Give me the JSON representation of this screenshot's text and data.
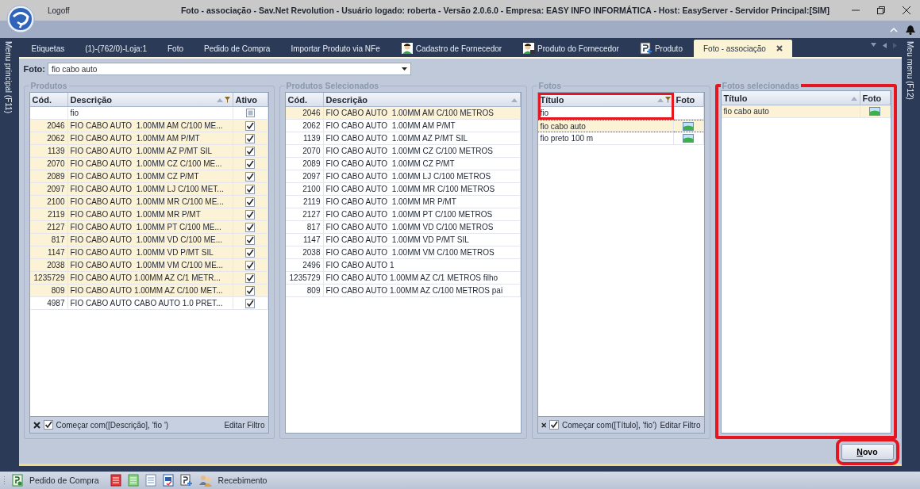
{
  "window": {
    "title": "Foto - associação - Sav.Net Revolution - Usuário logado: roberta - Versão 2.0.6.0 - Empresa: EASY INFO INFORMÁTICA - Host: EasyServer - Servidor Principal:[SIM]",
    "logoff": "Logoff"
  },
  "side_left": "Menu principal (F11)",
  "side_right": "Meu menu (F12)",
  "tabs": [
    {
      "label": "Etiquetas",
      "kind": "plain",
      "selected": false
    },
    {
      "label": "(1)-(762/0)-Loja:1",
      "kind": "plain",
      "selected": false
    },
    {
      "label": "Foto",
      "kind": "plain",
      "selected": false
    },
    {
      "label": "Pedido de Compra",
      "kind": "plain",
      "selected": false
    },
    {
      "label": "Importar Produto via NFe",
      "kind": "plain",
      "selected": false
    },
    {
      "label": "Cadastro de Fornecedor",
      "kind": "person",
      "selected": false
    },
    {
      "label": "Produto do Fornecedor",
      "kind": "supplier",
      "selected": false
    },
    {
      "label": "Produto",
      "kind": "product",
      "selected": false
    },
    {
      "label": "Foto - associação",
      "kind": "plain",
      "selected": true
    }
  ],
  "photo_field": {
    "label": "Foto:",
    "value": "fio cabo auto"
  },
  "panels": [
    {
      "title": "Produtos",
      "columns": [
        {
          "label": "Cód.",
          "kind": "code"
        },
        {
          "label": "Descrição",
          "kind": "text",
          "sorted": true,
          "filtered": true,
          "filter_value": "fio"
        },
        {
          "label": "Ativo",
          "kind": "check"
        }
      ],
      "rows": [
        {
          "values": [
            "2046",
            "FIO CABO AUTO  1.00MM AM C/100 ME..."
          ],
          "checked": true,
          "selected": true
        },
        {
          "values": [
            "2062",
            "FIO CABO AUTO  1.00MM AM P/MT"
          ],
          "checked": true,
          "selected": true
        },
        {
          "values": [
            "1139",
            "FIO CABO AUTO  1.00MM AZ P/MT SIL"
          ],
          "checked": true,
          "selected": true
        },
        {
          "values": [
            "2070",
            "FIO CABO AUTO  1.00MM CZ C/100 ME..."
          ],
          "checked": true,
          "selected": true
        },
        {
          "values": [
            "2089",
            "FIO CABO AUTO  1.00MM CZ P/MT"
          ],
          "checked": true,
          "selected": true
        },
        {
          "values": [
            "2097",
            "FIO CABO AUTO  1.00MM LJ C/100 MET..."
          ],
          "checked": true,
          "selected": true
        },
        {
          "values": [
            "2100",
            "FIO CABO AUTO  1.00MM MR C/100 ME..."
          ],
          "checked": true,
          "selected": true
        },
        {
          "values": [
            "2119",
            "FIO CABO AUTO  1.00MM MR P/MT"
          ],
          "checked": true,
          "selected": true
        },
        {
          "values": [
            "2127",
            "FIO CABO AUTO  1.00MM PT C/100 ME..."
          ],
          "checked": true,
          "selected": true
        },
        {
          "values": [
            "817",
            "FIO CABO AUTO  1.00MM VD C/100 ME..."
          ],
          "checked": true,
          "selected": true
        },
        {
          "values": [
            "1147",
            "FIO CABO AUTO  1.00MM VD P/MT SIL"
          ],
          "checked": true,
          "selected": true
        },
        {
          "values": [
            "2038",
            "FIO CABO AUTO  1.00MM VM C/100 ME..."
          ],
          "checked": true,
          "selected": true
        },
        {
          "values": [
            "1235729",
            "FIO CABO AUTO 1.00MM AZ C/1 METR..."
          ],
          "checked": true,
          "selected": true
        },
        {
          "values": [
            "809",
            "FIO CABO AUTO 1.00MM AZ C/100 MET..."
          ],
          "checked": true,
          "selected": true
        },
        {
          "values": [
            "4987",
            "FIO CABO AUTO CABO AUTO 1.0 PRET..."
          ],
          "checked": true,
          "selected": false
        }
      ],
      "filter": {
        "text": "Começar com([Descrição], 'fio ')",
        "checked": true,
        "edit": "Editar Filtro"
      }
    },
    {
      "title": "Produtos Selecionados",
      "columns": [
        {
          "label": "Cód.",
          "kind": "code"
        },
        {
          "label": "Descrição",
          "kind": "text",
          "sorted": true
        }
      ],
      "rows": [
        {
          "values": [
            "2046",
            "FIO CABO AUTO  1.00MM AM C/100 METROS"
          ],
          "selected": true
        },
        {
          "values": [
            "2062",
            "FIO CABO AUTO  1.00MM AM P/MT"
          ],
          "selected": false
        },
        {
          "values": [
            "1139",
            "FIO CABO AUTO  1.00MM AZ P/MT SIL"
          ],
          "selected": false
        },
        {
          "values": [
            "2070",
            "FIO CABO AUTO  1.00MM CZ C/100 METROS"
          ],
          "selected": false
        },
        {
          "values": [
            "2089",
            "FIO CABO AUTO  1.00MM CZ P/MT"
          ],
          "selected": false
        },
        {
          "values": [
            "2097",
            "FIO CABO AUTO  1.00MM LJ C/100 METROS"
          ],
          "selected": false
        },
        {
          "values": [
            "2100",
            "FIO CABO AUTO  1.00MM MR C/100 METROS"
          ],
          "selected": false
        },
        {
          "values": [
            "2119",
            "FIO CABO AUTO  1.00MM MR P/MT"
          ],
          "selected": false
        },
        {
          "values": [
            "2127",
            "FIO CABO AUTO  1.00MM PT C/100 METROS"
          ],
          "selected": false
        },
        {
          "values": [
            "817",
            "FIO CABO AUTO  1.00MM VD C/100 METROS"
          ],
          "selected": false
        },
        {
          "values": [
            "1147",
            "FIO CABO AUTO  1.00MM VD P/MT SIL"
          ],
          "selected": false
        },
        {
          "values": [
            "2038",
            "FIO CABO AUTO  1.00MM VM C/100 METROS"
          ],
          "selected": false
        },
        {
          "values": [
            "2496",
            "FIO CABO AUTO 1"
          ],
          "selected": false
        },
        {
          "values": [
            "1235729",
            "FIO CABO AUTO 1.00MM AZ C/1 METROS filho"
          ],
          "selected": false
        },
        {
          "values": [
            "809",
            "FIO CABO AUTO 1.00MM AZ C/100 METROS pai"
          ],
          "selected": false
        }
      ]
    },
    {
      "title": "Fotos",
      "columns": [
        {
          "label": "Título",
          "kind": "text",
          "sorted": true,
          "filtered": true,
          "highlighted": true,
          "filter_value": "fio"
        },
        {
          "label": "Foto",
          "kind": "photo"
        }
      ],
      "rows": [
        {
          "values": [
            "fio cabo auto"
          ],
          "photo": true,
          "selected": true
        },
        {
          "values": [
            "fio preto 100 m"
          ],
          "photo": true,
          "selected": false
        }
      ],
      "filter": {
        "text": "Começar com([Título], 'fio')",
        "checked": true,
        "edit": "Editar Filtro"
      }
    },
    {
      "title": "Fotos selecionadas",
      "highlighted": true,
      "columns": [
        {
          "label": "Título",
          "kind": "text",
          "sorted": true
        },
        {
          "label": "Foto",
          "kind": "photo"
        }
      ],
      "rows": [
        {
          "values": [
            "fio cabo auto"
          ],
          "photo": true,
          "selected": true
        }
      ]
    }
  ],
  "new_button": {
    "label": "Novo",
    "highlighted": true
  },
  "status_bar": [
    {
      "kind": "icon"
    },
    {
      "kind": "text",
      "label": "Pedido de Compra"
    },
    {
      "kind": "icon"
    },
    {
      "kind": "icon"
    },
    {
      "kind": "icon"
    },
    {
      "kind": "icon"
    },
    {
      "kind": "icon"
    },
    {
      "kind": "icon"
    },
    {
      "kind": "text",
      "label": "Recebimento"
    }
  ]
}
